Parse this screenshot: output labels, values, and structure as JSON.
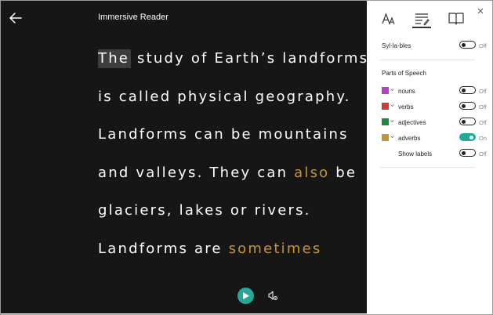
{
  "app": {
    "title": "Immersive Reader"
  },
  "reader": {
    "lines": [
      [
        {
          "text": "The",
          "style": "focus"
        },
        {
          "text": "study of Earth’s landforms",
          "style": "normal"
        }
      ],
      [
        {
          "text": "is called physical geography.",
          "style": "normal"
        }
      ],
      [
        {
          "text": "Landforms can be mountains",
          "style": "normal"
        }
      ],
      [
        {
          "text": "and valleys. They can",
          "style": "normal"
        },
        {
          "text": "also",
          "style": "adverb"
        },
        {
          "text": "be",
          "style": "normal"
        }
      ],
      [
        {
          "text": "glaciers, lakes or rivers.",
          "style": "normal"
        }
      ],
      [
        {
          "text": "Landforms are",
          "style": "normal"
        },
        {
          "text": "sometimes",
          "style": "adverb"
        }
      ]
    ],
    "icons": {
      "back": "back-arrow-icon",
      "play": "play-icon",
      "voice": "voice-settings-icon"
    }
  },
  "panel": {
    "tabs": [
      {
        "name": "text-preferences",
        "icon": "text-size-icon"
      },
      {
        "name": "grammar-options",
        "icon": "grammar-icon",
        "selected": true
      },
      {
        "name": "reading-preferences",
        "icon": "book-icon"
      }
    ],
    "syllables": {
      "label": "Syl·la·bles",
      "state": "Off",
      "on": false
    },
    "parts_of_speech": {
      "title": "Parts of Speech",
      "items": [
        {
          "label": "nouns",
          "color": "#b63fc6",
          "state": "Off",
          "on": false
        },
        {
          "label": "verbs",
          "color": "#d13a2e",
          "state": "Off",
          "on": false
        },
        {
          "label": "adjectives",
          "color": "#1f8a3a",
          "state": "Off",
          "on": false
        },
        {
          "label": "adverbs",
          "color": "#c5952f",
          "state": "On",
          "on": true
        }
      ],
      "show_labels": {
        "label": "Show labels",
        "state": "Off",
        "on": false
      }
    }
  },
  "colors": {
    "reader_bg": "#161616",
    "accent": "#25a89a",
    "adverb_highlight": "#c5952f"
  }
}
